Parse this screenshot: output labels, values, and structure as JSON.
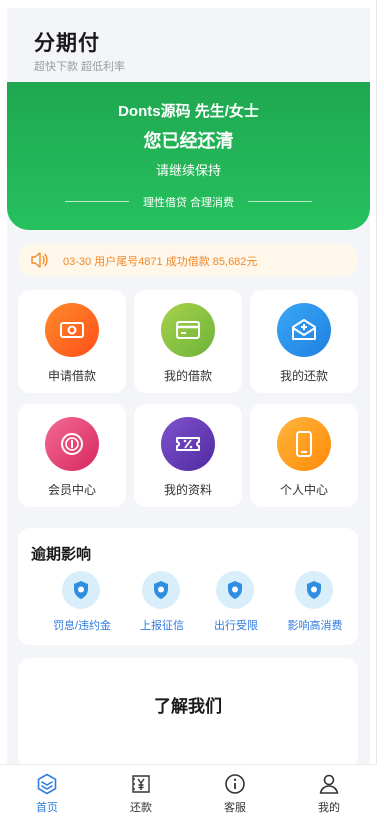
{
  "header": {
    "title": "分期付",
    "subtitle": "超快下款 超低利率"
  },
  "banner": {
    "user": "Donts源码 先生/女士",
    "status": "您已经还清",
    "tip": "请继续保持",
    "slogan": "理性借贷 合理消费",
    "gradient": [
      "#1fa751",
      "#26c15e"
    ]
  },
  "notice": {
    "icon": "speaker-icon",
    "text": "03-30 用户尾号4871 成功借款 85,682元",
    "color": "#f0892b"
  },
  "menu": [
    {
      "label": "申请借款",
      "icon": "money-icon",
      "color": "#ff6a1f"
    },
    {
      "label": "我的借款",
      "icon": "card-icon",
      "color": "#8cc43f"
    },
    {
      "label": "我的还款",
      "icon": "mail-icon",
      "color": "#2196f3"
    },
    {
      "label": "会员中心",
      "icon": "coin-icon",
      "color": "#ec4a7a"
    },
    {
      "label": "我的资料",
      "icon": "ticket-icon",
      "color": "#6a3db8"
    },
    {
      "label": "个人中心",
      "icon": "phone-icon",
      "color": "#ff9a1a"
    }
  ],
  "overdue": {
    "title": "逾期影响",
    "items": [
      {
        "label": "罚息/违约金",
        "icon": "shield-icon"
      },
      {
        "label": "上报征信",
        "icon": "shield-icon"
      },
      {
        "label": "出行受限",
        "icon": "shield-icon"
      },
      {
        "label": "影响高消费",
        "icon": "shield-icon"
      }
    ]
  },
  "about": {
    "title": "了解我们"
  },
  "tabbar": [
    {
      "label": "首页",
      "icon": "home-icon",
      "active": true
    },
    {
      "label": "还款",
      "icon": "yen-icon",
      "active": false
    },
    {
      "label": "客服",
      "icon": "info-icon",
      "active": false
    },
    {
      "label": "我的",
      "icon": "user-icon",
      "active": false
    }
  ],
  "colors": {
    "accent": "#2f7be0",
    "background": "#f4f5f9"
  }
}
